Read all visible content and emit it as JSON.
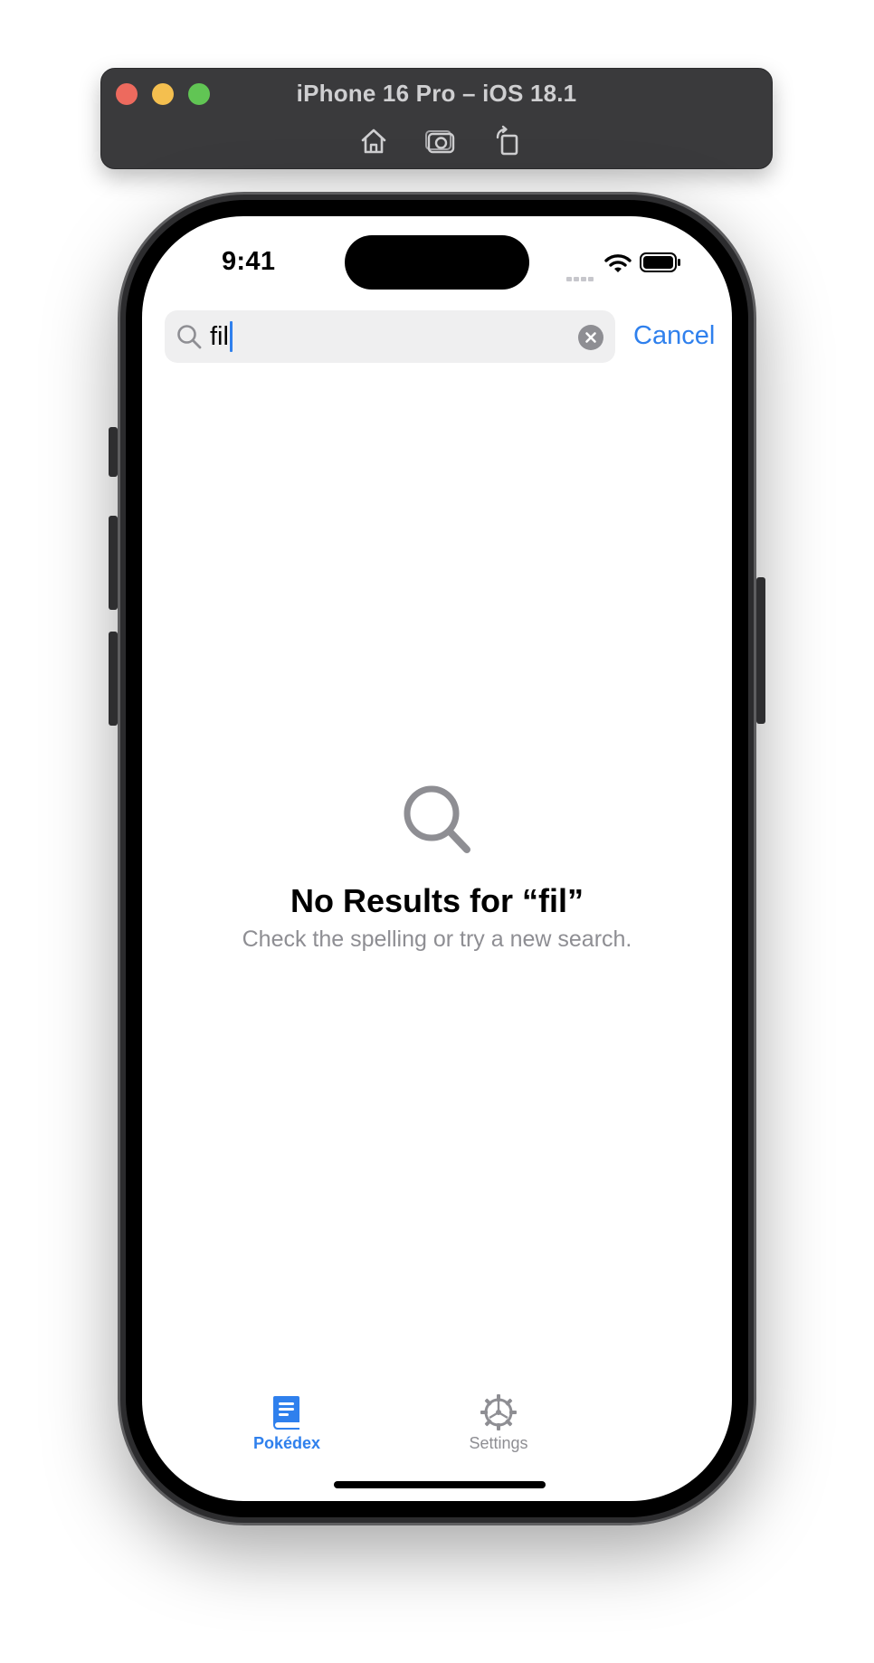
{
  "simulator": {
    "title": "iPhone 16 Pro – iOS 18.1",
    "tools": [
      "home-icon",
      "screenshot-icon",
      "rotate-icon"
    ]
  },
  "status_bar": {
    "time": "9:41"
  },
  "search": {
    "query": "fil",
    "cancel_label": "Cancel"
  },
  "empty_state": {
    "title": "No Results for “fil”",
    "subtitle": "Check the spelling or try a new search."
  },
  "tabs": [
    {
      "label": "Pokédex",
      "icon": "book-icon",
      "active": true
    },
    {
      "label": "Settings",
      "icon": "gear-icon",
      "active": false
    }
  ],
  "colors": {
    "accent": "#2f80ed",
    "secondary_text": "#8e8e93",
    "search_field_bg": "#efeff0"
  }
}
